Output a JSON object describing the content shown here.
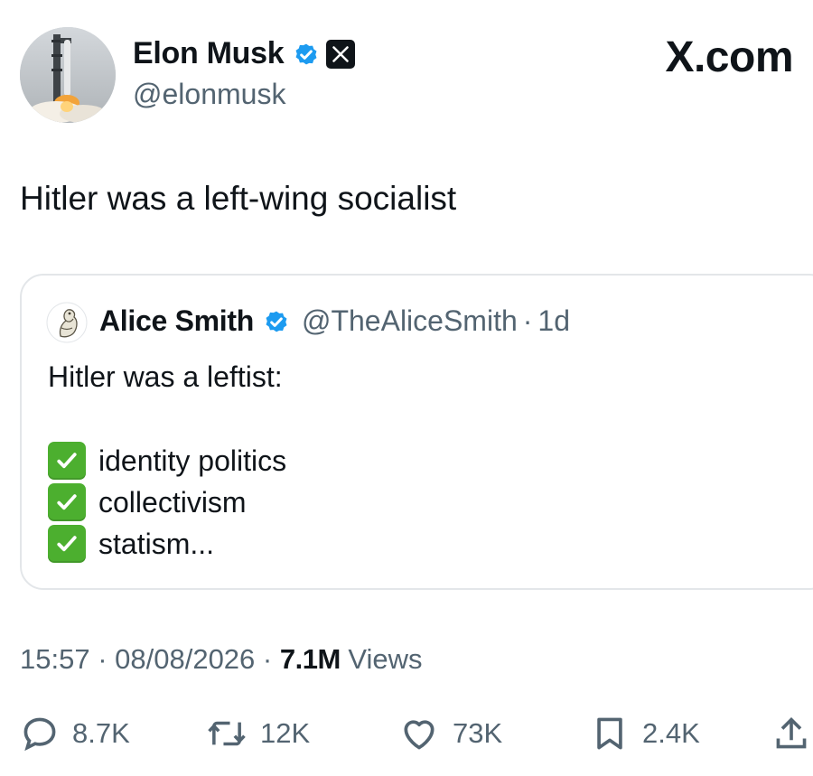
{
  "author": {
    "display_name": "Elon Musk",
    "handle": "@elonmusk"
  },
  "brand": "X.com",
  "tweet": {
    "text": "Hitler was a left-wing socialist"
  },
  "quote": {
    "display_name": "Alice Smith",
    "handle": "@TheAliceSmith",
    "separator": "·",
    "time": "1d",
    "text_line_1": "Hitler was a leftist:",
    "checklist": [
      "identity politics",
      "collectivism",
      "statism..."
    ]
  },
  "meta": {
    "time": "15:57",
    "separator_1": " · ",
    "date": "08/08/2026",
    "separator_2": " · ",
    "views_count": "7.1M",
    "views_label": " Views"
  },
  "actions": {
    "replies": "8.7K",
    "reposts": "12K",
    "likes": "73K",
    "bookmarks": "2.4K"
  },
  "colors": {
    "verified_blue": "#1d9bf0",
    "secondary_text": "#536471",
    "check_green": "#4caf2f",
    "border": "#e3e6e9"
  },
  "icons": {
    "verified": "verified-badge-icon",
    "x_logo": "x-logo-icon",
    "reply": "reply-icon",
    "repost": "repost-icon",
    "like": "heart-icon",
    "bookmark": "bookmark-icon",
    "share": "share-icon",
    "check": "check-mark-icon"
  }
}
